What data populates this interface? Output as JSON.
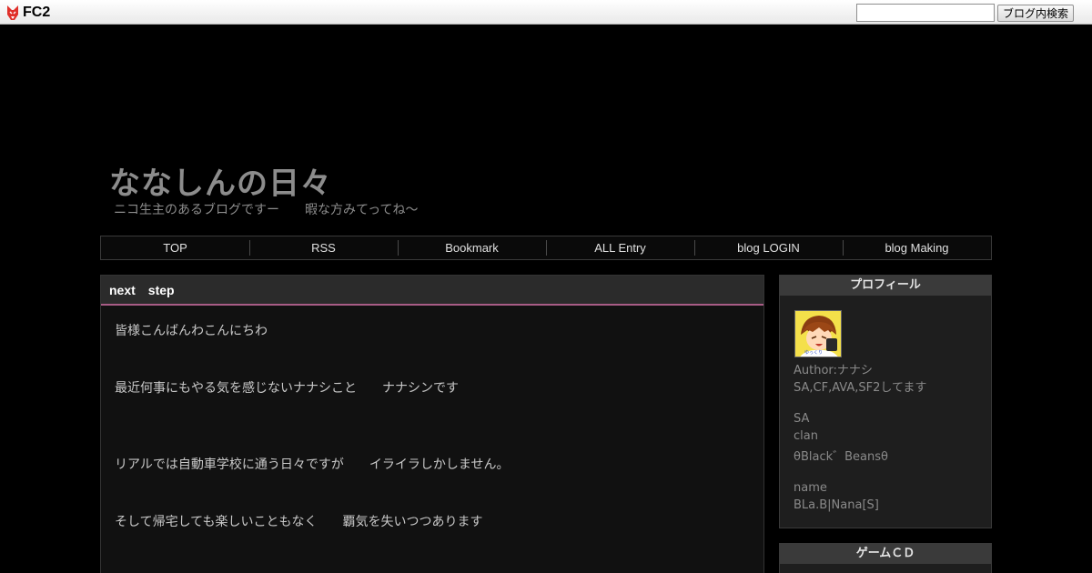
{
  "fc2bar": {
    "logo_text": "FC2",
    "search_placeholder": "",
    "search_button": "ブログ内検索"
  },
  "header": {
    "title": "ななしんの日々",
    "description": "ニコ生主のあるブログですー　　暇な方みてってね～"
  },
  "nav": {
    "items": [
      "TOP",
      "RSS",
      "Bookmark",
      "ALL Entry",
      "blog LOGIN",
      "blog Making"
    ]
  },
  "entry": {
    "title": "next　step",
    "lines": [
      "皆様こんばんわこんにちわ",
      "最近何事にもやる気を感じないナナシこと　　ナナシンです",
      "リアルでは自動車学校に通う日々ですが　　イライラしかしません。",
      "そして帰宅しても楽しいこともなく　　覇気を失いつつあります"
    ]
  },
  "sidebar": {
    "profile": {
      "title": "プロフィール",
      "lines": [
        "Author:ナナシ",
        "SA,CF,AVA,SF2してます",
        "",
        "SA",
        "clan",
        "θBlack゛Beansθ",
        "",
        "name",
        "BLa.B|Nana[S]"
      ]
    },
    "game": {
      "title": "ゲームＣＤ"
    }
  },
  "colors": {
    "background": "#000000",
    "accent_underline": "#a85c86",
    "title_gray": "#8c8c8c"
  }
}
